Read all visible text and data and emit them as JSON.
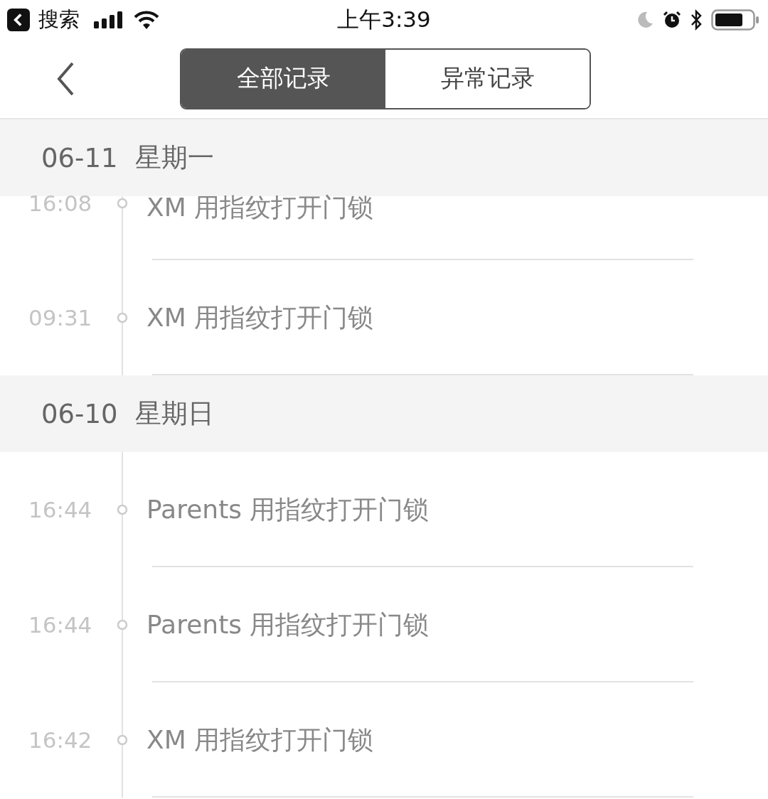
{
  "status_bar": {
    "back_label": "搜索",
    "time": "上午3:39"
  },
  "tabs": [
    {
      "label": "全部记录",
      "selected": true
    },
    {
      "label": "异常记录",
      "selected": false
    }
  ],
  "sections": [
    {
      "date": "06-11",
      "weekday": "星期一",
      "records": [
        {
          "time": "16:08",
          "text": "XM 用指纹打开门锁"
        },
        {
          "time": "09:31",
          "text": "XM 用指纹打开门锁"
        }
      ]
    },
    {
      "date": "06-10",
      "weekday": "星期日",
      "records": [
        {
          "time": "16:44",
          "text": "Parents 用指纹打开门锁"
        },
        {
          "time": "16:44",
          "text": "Parents 用指纹打开门锁"
        },
        {
          "time": "16:42",
          "text": "XM 用指纹打开门锁"
        }
      ]
    }
  ]
}
